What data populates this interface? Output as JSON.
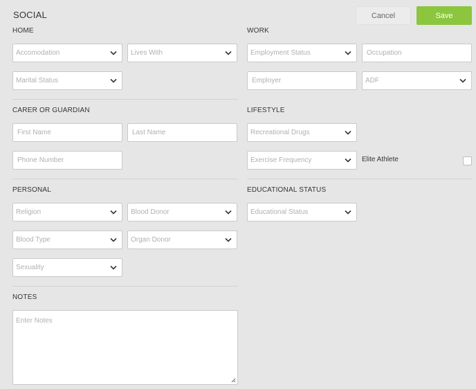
{
  "page": {
    "title": "SOCIAL"
  },
  "actions": {
    "cancel_label": "Cancel",
    "save_label": "Save"
  },
  "home": {
    "heading": "HOME",
    "accommodation": "Accomodation",
    "lives_with": "Lives With",
    "marital_status": "Marital Status"
  },
  "work": {
    "heading": "WORK",
    "employment_status": "Employment Status",
    "occupation_placeholder": "Occupation",
    "employer_placeholder": "Employer",
    "adf": "ADF"
  },
  "carer": {
    "heading": "CARER OR GUARDIAN",
    "first_name_placeholder": "First Name",
    "last_name_placeholder": "Last Name",
    "phone_placeholder": "Phone Number"
  },
  "lifestyle": {
    "heading": "LIFESTYLE",
    "recreational_drugs": "Recreational Drugs",
    "exercise_frequency": "Exercise Frequency",
    "elite_athlete_label": "Elite Athlete"
  },
  "personal": {
    "heading": "PERSONAL",
    "religion": "Religion",
    "blood_donor": "Blood Donor",
    "blood_type": "Blood Type",
    "organ_donor": "Organ Donor",
    "sexuality": "Sexuality"
  },
  "education": {
    "heading": "EDUCATIONAL STATUS",
    "status": "Educational Status"
  },
  "notes": {
    "heading": "NOTES",
    "placeholder": "Enter Notes"
  },
  "icons": {
    "dropdown": "chevron-down-icon",
    "resize": "resize-handle-icon"
  },
  "colors": {
    "save": "#8cc63f",
    "background": "#e6e6e6"
  }
}
